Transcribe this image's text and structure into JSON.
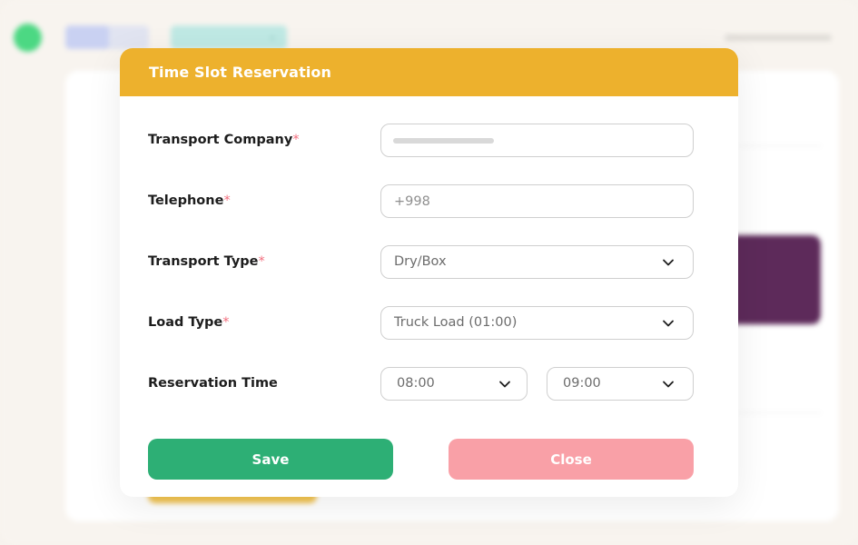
{
  "modal": {
    "title": "Time Slot Reservation",
    "required_marker": "*",
    "fields": {
      "transport_company": {
        "label": "Transport Company",
        "value": ""
      },
      "telephone": {
        "label": "Telephone",
        "placeholder": "+998"
      },
      "transport_type": {
        "label": "Transport Type",
        "value": "Dry/Box"
      },
      "load_type": {
        "label": "Load Type",
        "value": "Truck Load (01:00)"
      },
      "reservation_time": {
        "label": "Reservation Time",
        "start": "08:00",
        "end": "09:00"
      }
    },
    "buttons": {
      "save": "Save",
      "close": "Close"
    }
  },
  "colors": {
    "header": "#edb12d",
    "save": "#2daf75",
    "close": "#f9a0a7",
    "required": "#f26d7d"
  }
}
